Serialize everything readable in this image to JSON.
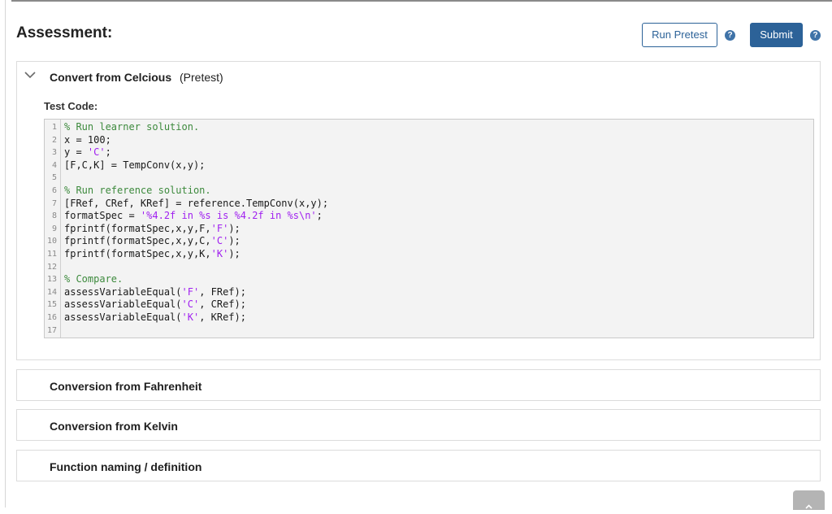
{
  "assessment": {
    "heading": "Assessment:",
    "run_pretest_label": "Run Pretest",
    "submit_label": "Submit",
    "help_glyph": "?",
    "colors": {
      "primary": "#2c6298",
      "help": "#3f73a8"
    }
  },
  "tests": [
    {
      "title": "Convert from Celcious",
      "tag": "(Pretest)",
      "expanded": true,
      "test_code_label": "Test Code:",
      "code": [
        "% Run learner solution.",
        "x = 100;",
        "y = 'C';",
        "[F,C,K] = TempConv(x,y);",
        "",
        "% Run reference solution.",
        "[FRef, CRef, KRef] = reference.TempConv(x,y);",
        "formatSpec = '%4.2f in %s is %4.2f in %s\\n';",
        "fprintf(formatSpec,x,y,F,'F');",
        "fprintf(formatSpec,x,y,C,'C');",
        "fprintf(formatSpec,x,y,K,'K');",
        "",
        "% Compare.",
        "assessVariableEqual('F', FRef);",
        "assessVariableEqual('C', CRef);",
        "assessVariableEqual('K', KRef);",
        ""
      ]
    },
    {
      "title": "Conversion from Fahrenheit",
      "expanded": false
    },
    {
      "title": "Conversion from Kelvin",
      "expanded": false
    },
    {
      "title": "Function naming / definition",
      "expanded": false
    }
  ],
  "icons": {
    "expand": "chevron-down-icon",
    "help": "question-circle-icon",
    "scroll_top": "chevron-up-icon"
  }
}
